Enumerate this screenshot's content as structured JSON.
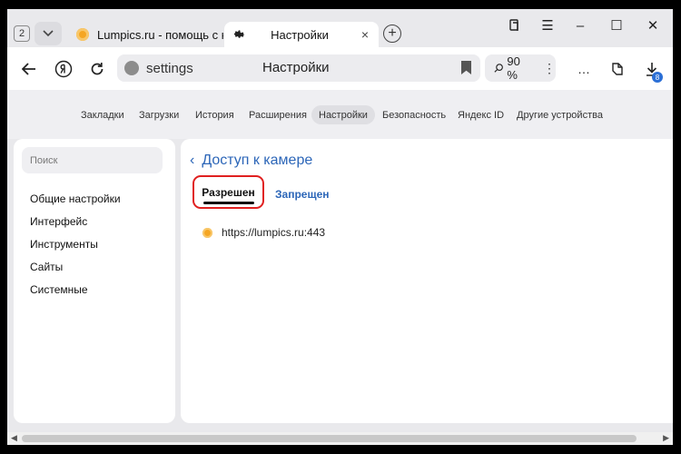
{
  "tabstrip": {
    "tab_count": "2",
    "tabs": [
      {
        "title": "Lumpics.ru - помощь с компьютером",
        "close": ""
      },
      {
        "title": "Настройки",
        "close": "×"
      }
    ],
    "new_tab": "+"
  },
  "window_controls": {
    "minimize": "–",
    "maximize": "☐",
    "close": "✕",
    "menu": "☰"
  },
  "toolbar": {
    "url": "settings",
    "page_title": "Настройки",
    "zoom": "90 %",
    "zoom_more": "⋮",
    "more": "…",
    "downloads_badge": "8"
  },
  "settings_nav": {
    "items": [
      "Закладки",
      "Загрузки",
      "История",
      "Расширения",
      "Настройки",
      "Безопасность",
      "Яндекс ID",
      "Другие устройства"
    ],
    "active": "Настройки"
  },
  "sidebar": {
    "search_placeholder": "Поиск",
    "items": [
      "Общие настройки",
      "Интерфейс",
      "Инструменты",
      "Сайты",
      "Системные"
    ]
  },
  "main": {
    "back_title": "Доступ к камере",
    "tab_allowed": "Разрешен",
    "tab_blocked": "Запрещен",
    "sites": [
      "https://lumpics.ru:443"
    ]
  },
  "colors": {
    "accent": "#2c66b8",
    "highlight": "#e02020"
  }
}
